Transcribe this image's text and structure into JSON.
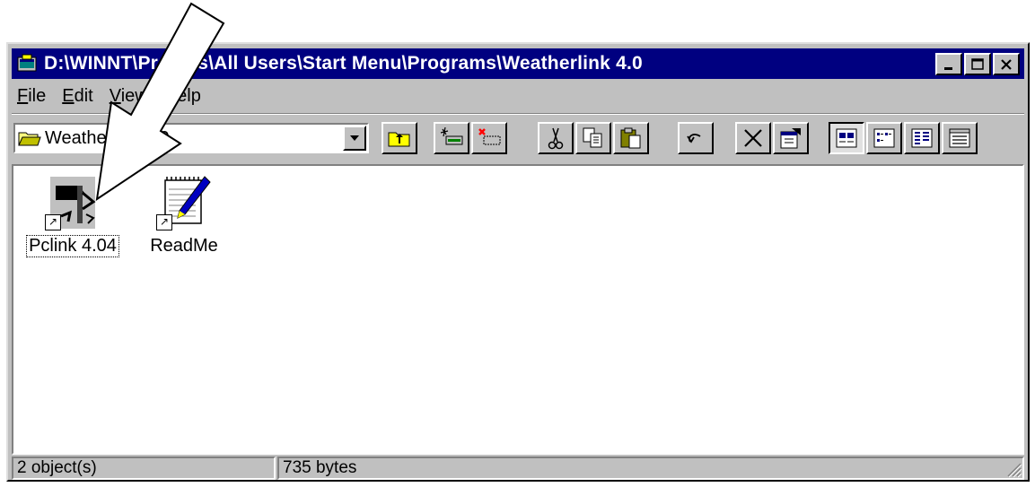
{
  "window": {
    "title": "D:\\WINNT\\Profiles\\All Users\\Start Menu\\Programs\\Weatherlink 4.0",
    "controls": {
      "minimize": "_",
      "maximize": "□",
      "close": "✕"
    }
  },
  "menu": {
    "items": [
      {
        "label": "File",
        "accel": "F"
      },
      {
        "label": "Edit",
        "accel": "E"
      },
      {
        "label": "View",
        "accel": "V"
      },
      {
        "label": "Help",
        "accel": "H"
      }
    ]
  },
  "toolbar": {
    "address_value": "Weatherlink 4.0",
    "buttons": [
      "up-one-level-icon",
      "map-drive-icon",
      "disconnect-drive-icon",
      "cut-icon",
      "copy-icon",
      "paste-icon",
      "undo-icon",
      "delete-icon",
      "properties-icon",
      "large-icons-view-icon",
      "small-icons-view-icon",
      "list-view-icon",
      "details-view-icon"
    ]
  },
  "files": [
    {
      "label": "Pclink 4.04",
      "icon": "weather-station-icon",
      "selected": true
    },
    {
      "label": "ReadMe",
      "icon": "notepad-icon",
      "selected": false
    }
  ],
  "status": {
    "objects": "2 object(s)",
    "size": "735 bytes"
  },
  "colors": {
    "title_bg": "#000080",
    "face": "#c0c0c0",
    "window_bg": "#ffffff"
  }
}
